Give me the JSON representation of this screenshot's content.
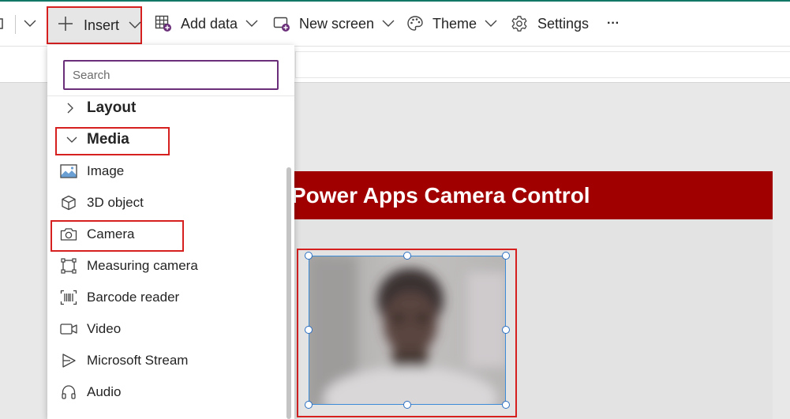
{
  "commandbar": {
    "insert_label": "Insert",
    "add_data_label": "Add data",
    "new_screen_label": "New screen",
    "theme_label": "Theme",
    "settings_label": "Settings",
    "more_label": "···"
  },
  "insert_panel": {
    "search_placeholder": "Search",
    "groups": {
      "layout": "Layout",
      "media": "Media"
    },
    "items": {
      "image": "Image",
      "object3d": "3D object",
      "camera": "Camera",
      "measuring_camera": "Measuring camera",
      "barcode_reader": "Barcode reader",
      "video": "Video",
      "microsoft_stream": "Microsoft Stream",
      "audio": "Audio"
    }
  },
  "canvas": {
    "screen_title": "Power Apps Camera Control"
  },
  "colors": {
    "accent_red": "#d62020",
    "header_red": "#a10000",
    "search_border": "#6b2f7a",
    "selection_blue": "#3b8bd6"
  }
}
